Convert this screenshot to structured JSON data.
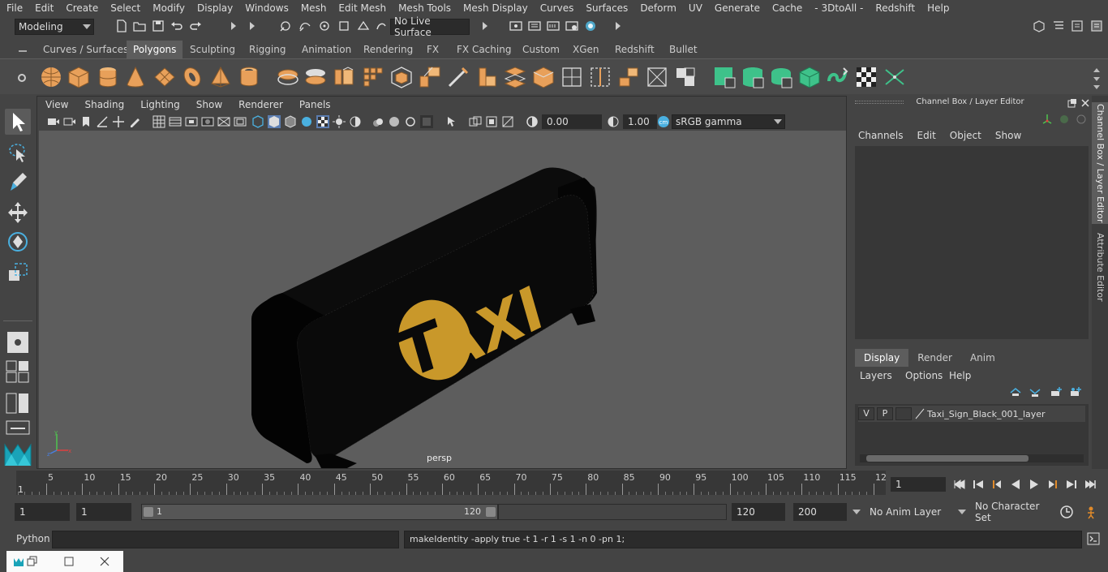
{
  "menubar": {
    "items": [
      "File",
      "Edit",
      "Create",
      "Select",
      "Modify",
      "Display",
      "Windows",
      "Mesh",
      "Edit Mesh",
      "Mesh Tools",
      "Mesh Display",
      "Curves",
      "Surfaces",
      "Deform",
      "UV",
      "Generate",
      "Cache",
      "- 3DtoAll -",
      "Redshift",
      "Help"
    ]
  },
  "statusline": {
    "mode": "Modeling",
    "live_surface": "No Live Surface"
  },
  "shelf": {
    "tabs": [
      "Curves / Surfaces",
      "Polygons",
      "Sculpting",
      "Rigging",
      "Animation",
      "Rendering",
      "FX",
      "FX Caching",
      "Custom",
      "XGen",
      "Redshift",
      "Bullet"
    ],
    "active_tab": "Polygons"
  },
  "viewport": {
    "menu": [
      "View",
      "Shading",
      "Lighting",
      "Show",
      "Renderer",
      "Panels"
    ],
    "exposure": "0.00",
    "gamma": "1.00",
    "color_space": "sRGB gamma",
    "camera_label": "persp",
    "sign_text": "AXI",
    "sign_badge": "T",
    "colors": {
      "sign_body": "#0a0a0a",
      "sign_logo": "#c9982a",
      "background": "#5d5d5d"
    }
  },
  "right_panel": {
    "title": "Channel Box / Layer Editor",
    "channel_menu": [
      "Channels",
      "Edit",
      "Object",
      "Show"
    ],
    "layer_tabs": [
      "Display",
      "Render",
      "Anim"
    ],
    "layer_menu": [
      "Layers",
      "Options",
      "Help"
    ],
    "layer": {
      "v": "V",
      "p": "P",
      "name": "Taxi_Sign_Black_001_layer"
    },
    "side_tabs": [
      "Channel Box / Layer Editor",
      "Attribute Editor"
    ]
  },
  "timeline": {
    "ticks": [
      "5",
      "10",
      "15",
      "20",
      "25",
      "30",
      "35",
      "40",
      "45",
      "50",
      "55",
      "60",
      "65",
      "70",
      "75",
      "80",
      "85",
      "90",
      "95",
      "100",
      "105",
      "110",
      "115",
      "12"
    ],
    "start_label": "1",
    "current_frame": "1"
  },
  "range": {
    "start": "1",
    "playback_start": "1",
    "slider_start": "1",
    "slider_end": "120",
    "playback_end": "120",
    "end": "200",
    "anim_layer": "No Anim Layer",
    "char_set": "No Character Set"
  },
  "cmdline": {
    "language": "Python",
    "result": "makeIdentity -apply true -t 1 -r 1 -s 1 -n 0 -pn 1;"
  }
}
